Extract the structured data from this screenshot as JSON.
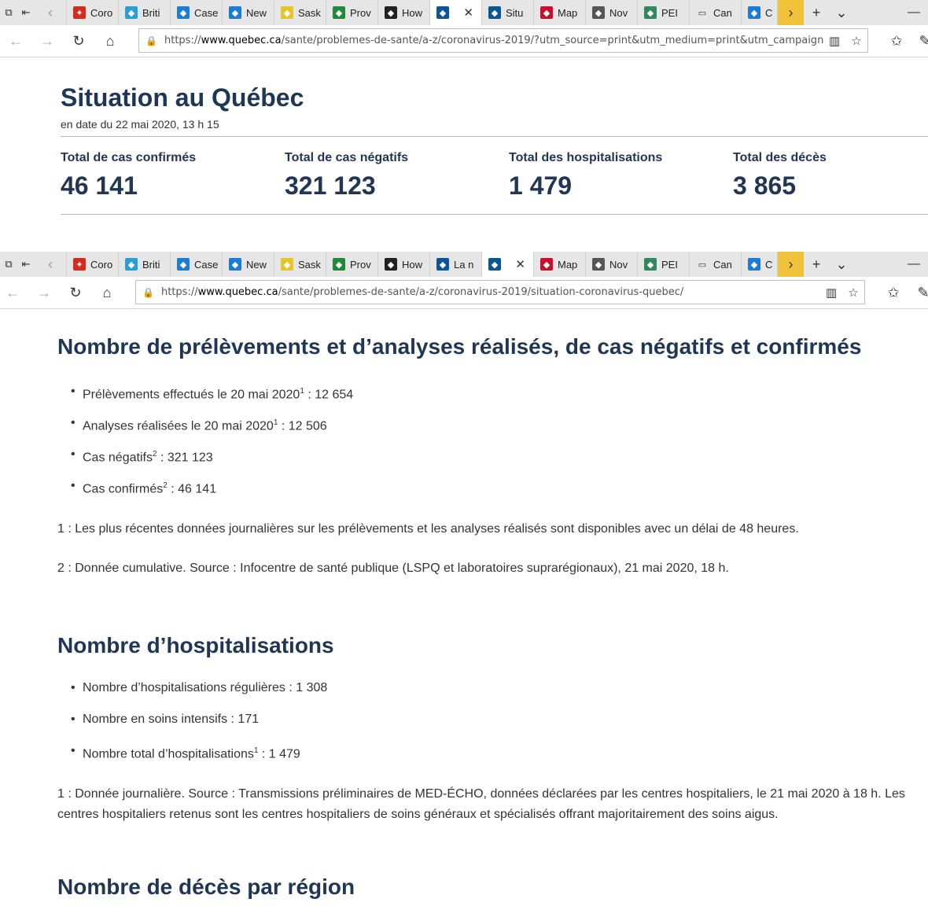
{
  "browser": {
    "tabs_top": [
      {
        "label": "Coro",
        "icon": "maple-leaf-icon",
        "color": "#d52b1e"
      },
      {
        "label": "Briti",
        "icon": "bc-icon",
        "color": "#2a9fd6"
      },
      {
        "label": "Case",
        "icon": "alberta-icon",
        "color": "#1d7bd8"
      },
      {
        "label": "New",
        "icon": "alberta-icon",
        "color": "#1d7bd8"
      },
      {
        "label": "Sask",
        "icon": "saskatchewan-icon",
        "color": "#e4c62b"
      },
      {
        "label": "Prov",
        "icon": "manitoba-icon",
        "color": "#1f8a3a"
      },
      {
        "label": "How",
        "icon": "ontario-icon",
        "color": "#222222"
      },
      {
        "label": "",
        "icon": "quebec-icon",
        "color": "#095797",
        "active": true
      },
      {
        "label": "Situ",
        "icon": "quebec-icon",
        "color": "#095797"
      },
      {
        "label": "Map",
        "icon": "nb-icon",
        "color": "#c8102e"
      },
      {
        "label": "Nov",
        "icon": "ns-icon",
        "color": "#555555"
      },
      {
        "label": "PEI",
        "icon": "pei-icon",
        "color": "#2e8b57"
      },
      {
        "label": "Can",
        "icon": "window-icon",
        "color": "#333333"
      },
      {
        "label": "C",
        "icon": "nl-icon",
        "color": "#1d7bd8"
      }
    ],
    "tabs_bottom": [
      {
        "label": "Coro",
        "icon": "maple-leaf-icon",
        "color": "#d52b1e"
      },
      {
        "label": "Briti",
        "icon": "bc-icon",
        "color": "#2a9fd6"
      },
      {
        "label": "Case",
        "icon": "alberta-icon",
        "color": "#1d7bd8"
      },
      {
        "label": "New",
        "icon": "alberta-icon",
        "color": "#1d7bd8"
      },
      {
        "label": "Sask",
        "icon": "saskatchewan-icon",
        "color": "#e4c62b"
      },
      {
        "label": "Prov",
        "icon": "manitoba-icon",
        "color": "#1f8a3a"
      },
      {
        "label": "How",
        "icon": "ontario-icon",
        "color": "#222222"
      },
      {
        "label": "La n",
        "icon": "quebec-icon",
        "color": "#095797"
      },
      {
        "label": "",
        "icon": "quebec-icon",
        "color": "#095797",
        "active": true
      },
      {
        "label": "Map",
        "icon": "nb-icon",
        "color": "#c8102e"
      },
      {
        "label": "Nov",
        "icon": "ns-icon",
        "color": "#555555"
      },
      {
        "label": "PEI",
        "icon": "pei-icon",
        "color": "#2e8b57"
      },
      {
        "label": "Can",
        "icon": "window-icon",
        "color": "#333333"
      },
      {
        "label": "C",
        "icon": "nl-icon",
        "color": "#1d7bd8"
      }
    ],
    "url_top_prefix": "https://",
    "url_top_domain": "www.quebec.ca",
    "url_top_path": "/sante/problemes-de-sante/a-z/coronavirus-2019/?utm_source=print&utm_medium=print&utm_campaign=coronavirus",
    "url_bottom_prefix": "https://",
    "url_bottom_domain": "www.quebec.ca",
    "url_bottom_path": "/sante/problemes-de-sante/a-z/coronavirus-2019/situation-coronavirus-quebec/"
  },
  "situation": {
    "title": "Situation au Québec",
    "date": "en date du 22 mai 2020, 13 h 15",
    "stats": [
      {
        "label": "Total de cas confirmés",
        "value": "46 141"
      },
      {
        "label": "Total de cas négatifs",
        "value": "321 123"
      },
      {
        "label": "Total des hospitalisations",
        "value": "1 479"
      },
      {
        "label": "Total des décès",
        "value": "3 865"
      }
    ]
  },
  "section1": {
    "heading": "Nombre de prélèvements et d’analyses réalisés, de cas négatifs et confirmés",
    "items": [
      {
        "text": "Prélèvements effectués le 20 mai 2020",
        "sup": "1",
        "value": " : 12 654"
      },
      {
        "text": "Analyses réalisées le 20 mai 2020",
        "sup": "1",
        "value": " : 12 506"
      },
      {
        "text": "Cas négatifs",
        "sup": "2",
        "value": " : 321 123"
      },
      {
        "text": "Cas confirmés",
        "sup": "2",
        "value": " : 46 141"
      }
    ],
    "note1": "1 : Les plus récentes données journalières sur les prélèvements et les analyses réalisés sont disponibles avec un délai de 48 heures.",
    "note2": "2 : Donnée cumulative. Source : Infocentre de santé publique (LSPQ et laboratoires suprarégionaux), 21 mai 2020, 18 h."
  },
  "section2": {
    "heading": "Nombre d’hospitalisations",
    "items": [
      {
        "text": "Nombre d’hospitalisations régulières : 1 308",
        "sup": "",
        "value": ""
      },
      {
        "text": "Nombre en soins intensifs : 171",
        "sup": "",
        "value": ""
      },
      {
        "text": "Nombre total d’hospitalisations",
        "sup": "1",
        "value": " : 1 479"
      }
    ],
    "note1": "1 : Donnée journalière. Source : Transmissions préliminaires de MED-ÉCHO, données déclarées par les centres hospitaliers, le 21 mai 2020 à 18 h. Les centres hospitaliers retenus sont les centres hospitaliers de soins généraux et spécialisés offrant majoritairement des soins aigus."
  },
  "section3": {
    "heading": "Nombre de décès par région"
  }
}
